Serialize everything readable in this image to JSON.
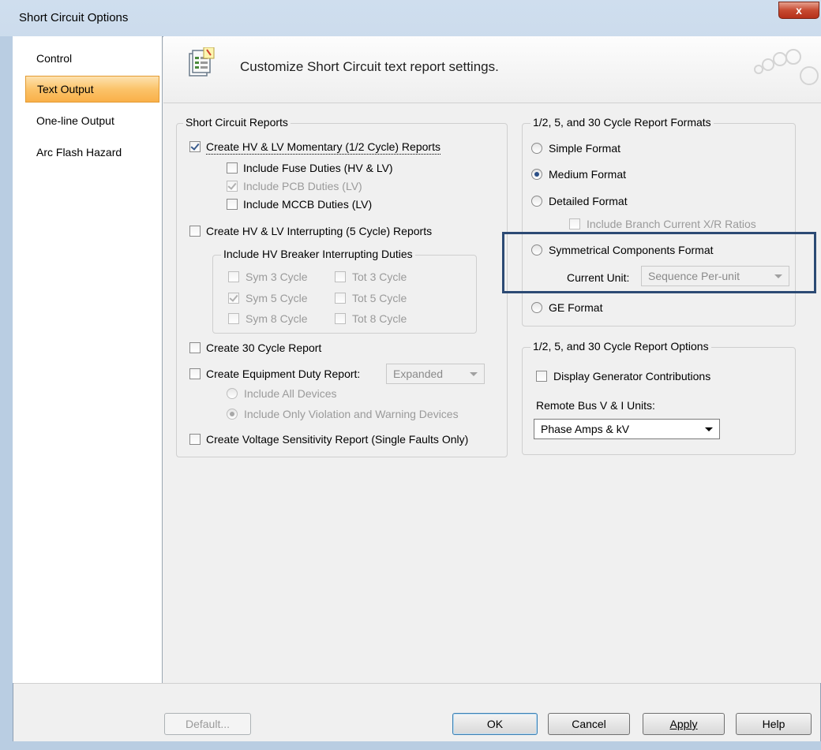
{
  "window": {
    "title": "Short Circuit Options",
    "close_glyph": "x"
  },
  "nav": {
    "items": [
      {
        "label": "Control"
      },
      {
        "label": "Text Output"
      },
      {
        "label": "One-line Output"
      },
      {
        "label": "Arc Flash Hazard"
      }
    ],
    "selected": "Text Output"
  },
  "header": {
    "text": "Customize Short Circuit text report settings.",
    "icon": "report-settings-icon"
  },
  "reports": {
    "title": "Short Circuit Reports",
    "momentary": {
      "label": "Create HV & LV Momentary (1/2 Cycle) Reports",
      "checked": true
    },
    "fuse_duties": {
      "label": "Include Fuse Duties (HV & LV)",
      "checked": false
    },
    "pcb_duties": {
      "label": "Include PCB Duties (LV)",
      "checked": true
    },
    "mccb_duties": {
      "label": "Include MCCB Duties (LV)",
      "checked": false
    },
    "interrupting": {
      "label": "Create HV & LV Interrupting (5 Cycle) Reports",
      "checked": false
    },
    "hv_breaker": {
      "title": "Include HV Breaker Interrupting Duties",
      "sym3": {
        "label": "Sym 3 Cycle",
        "checked": false
      },
      "tot3": {
        "label": "Tot 3 Cycle",
        "checked": false
      },
      "sym5": {
        "label": "Sym 5 Cycle",
        "checked": true
      },
      "tot5": {
        "label": "Tot 5 Cycle",
        "checked": false
      },
      "sym8": {
        "label": "Sym 8 Cycle",
        "checked": false
      },
      "tot8": {
        "label": "Tot 8 Cycle",
        "checked": false
      }
    },
    "cycle30": {
      "label": "Create 30 Cycle Report",
      "checked": false
    },
    "equipment_duty": {
      "label": "Create Equipment Duty Report:",
      "checked": false,
      "dropdown_value": "Expanded"
    },
    "all_devices": {
      "label": "Include All Devices",
      "selected": false
    },
    "violation_devices": {
      "label": "Include Only Violation and Warning Devices",
      "selected": true
    },
    "voltage_sensitivity": {
      "label": "Create Voltage Sensitivity Report (Single Faults Only)",
      "checked": false
    }
  },
  "formats": {
    "title": "1/2, 5, and 30 Cycle Report Formats",
    "simple": {
      "label": "Simple Format",
      "selected": false
    },
    "medium": {
      "label": "Medium Format",
      "selected": true
    },
    "detailed": {
      "label": "Detailed Format",
      "selected": false
    },
    "branch_xr": {
      "label": "Include Branch Current X/R Ratios",
      "checked": false
    },
    "symmetrical": {
      "label": "Symmetrical Components Format",
      "selected": false
    },
    "current_unit_label": "Current Unit:",
    "current_unit_value": "Sequence Per-unit",
    "ge": {
      "label": "GE Format",
      "selected": false
    }
  },
  "options": {
    "title": "1/2, 5, and 30 Cycle Report Options",
    "gen_contrib": {
      "label": "Display Generator Contributions",
      "checked": false
    },
    "remote_bus_label": "Remote Bus V & I Units:",
    "remote_bus_value": "Phase Amps & kV"
  },
  "footer": {
    "default_label": "Default...",
    "ok_label": "OK",
    "cancel_label": "Cancel",
    "apply_label": "Apply",
    "help_label": "Help"
  },
  "colors": {
    "selected_nav": "#f9b049",
    "highlight_box": "#2c4a74",
    "close_button": "#c74a31"
  }
}
